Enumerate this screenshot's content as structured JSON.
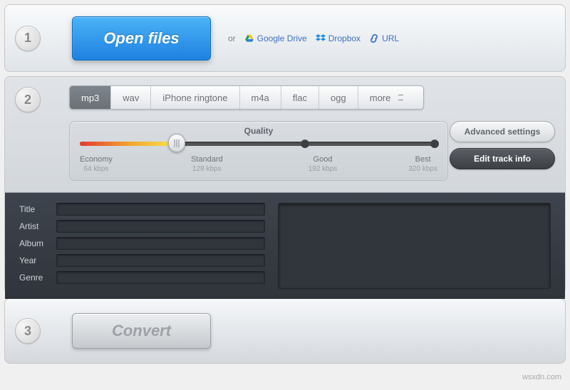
{
  "steps": {
    "one": "1",
    "two": "2",
    "three": "3"
  },
  "open": {
    "button": "Open files",
    "or": "or",
    "gdrive": "Google Drive",
    "dropbox": "Dropbox",
    "url": "URL"
  },
  "formats": {
    "mp3": "mp3",
    "wav": "wav",
    "ringtone": "iPhone ringtone",
    "m4a": "m4a",
    "flac": "flac",
    "ogg": "ogg",
    "more": "more"
  },
  "quality": {
    "title": "Quality",
    "economy": {
      "label": "Economy",
      "rate": "64 kbps"
    },
    "standard": {
      "label": "Standard",
      "rate": "128 kbps"
    },
    "good": {
      "label": "Good",
      "rate": "192 kbps"
    },
    "best": {
      "label": "Best",
      "rate": "320 kbps"
    }
  },
  "side": {
    "advanced": "Advanced settings",
    "edit": "Edit track info"
  },
  "tags": {
    "title": "Title",
    "artist": "Artist",
    "album": "Album",
    "year": "Year",
    "genre": "Genre"
  },
  "convert": "Convert",
  "watermark": "wsxdn.com"
}
